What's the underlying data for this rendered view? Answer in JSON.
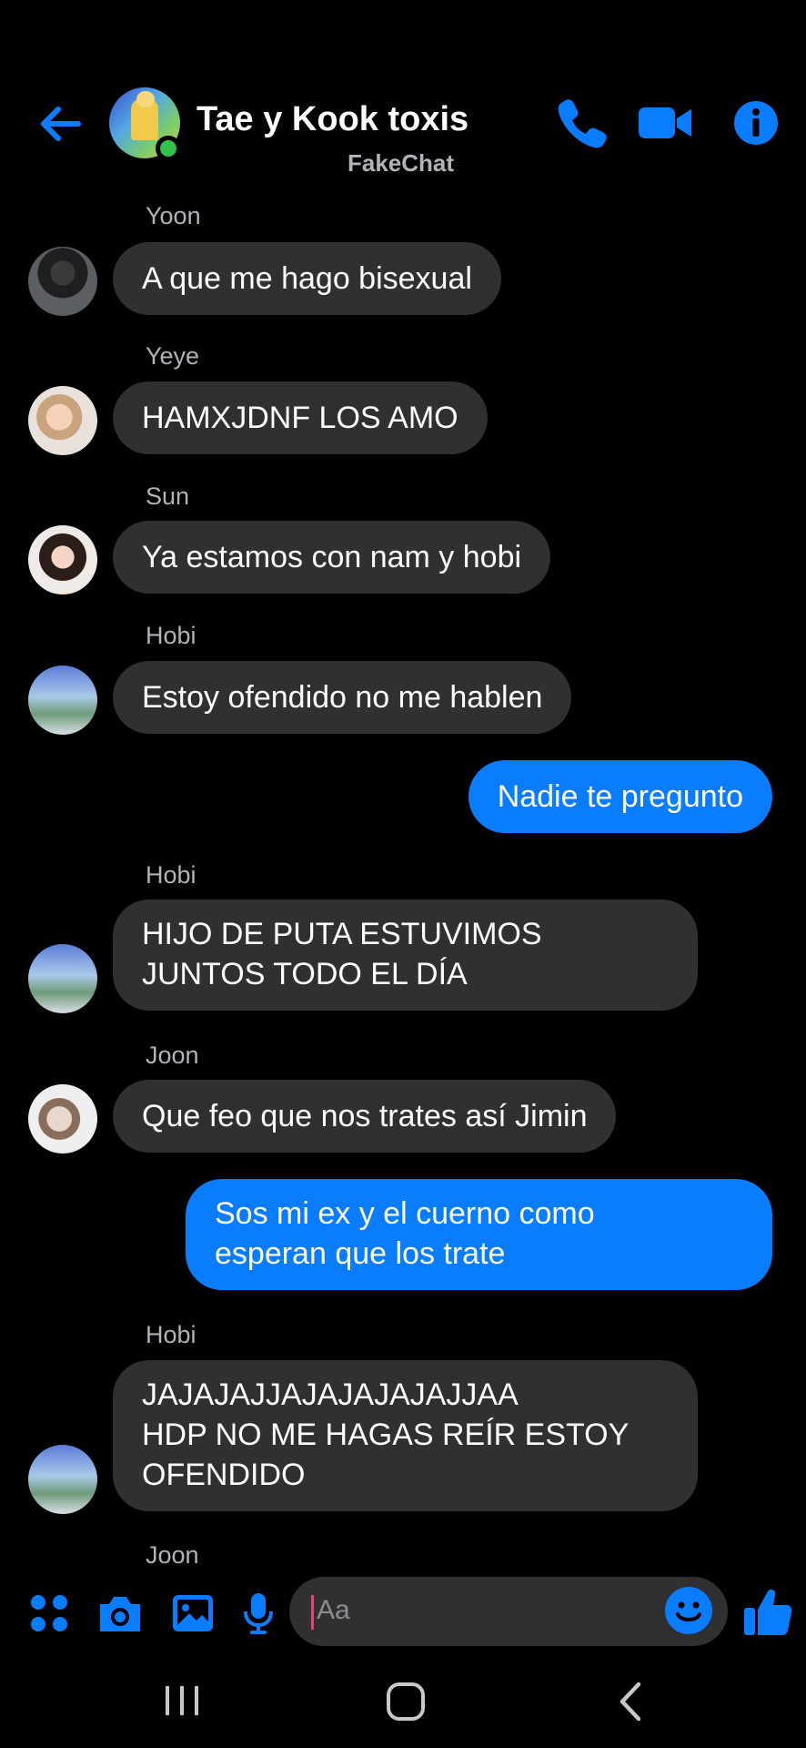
{
  "header": {
    "title": "Tae y Kook toxis",
    "subtitle": "FakeChat"
  },
  "messages": [
    {
      "sender": "Yoon",
      "direction": "incoming",
      "lines": [
        "A que me hago bisexual"
      ]
    },
    {
      "sender": "Yeye",
      "direction": "incoming",
      "lines": [
        "HAMXJDNF LOS AMO"
      ]
    },
    {
      "sender": "Sun",
      "direction": "incoming",
      "lines": [
        "Ya estamos con nam y hobi"
      ]
    },
    {
      "sender": "Hobi",
      "direction": "incoming",
      "lines": [
        "Estoy ofendido no me hablen"
      ]
    },
    {
      "sender": "",
      "direction": "outgoing",
      "lines": [
        "Nadie te pregunto"
      ]
    },
    {
      "sender": "Hobi",
      "direction": "incoming",
      "lines": [
        "HIJO DE PUTA ESTUVIMOS",
        "JUNTOS TODO EL DÍA"
      ]
    },
    {
      "sender": "Joon",
      "direction": "incoming",
      "lines": [
        "Que feo que nos trates así Jimin"
      ]
    },
    {
      "sender": "",
      "direction": "outgoing",
      "lines": [
        "Sos mi ex y el cuerno como",
        "esperan que los trate"
      ]
    },
    {
      "sender": "Hobi",
      "direction": "incoming",
      "lines": [
        "JAJAJAJJAJAJAJAJAJJAA",
        "HDP NO ME HAGAS REÍR ESTOY",
        "OFENDIDO"
      ]
    },
    {
      "sender": "Joon",
      "direction": "incoming",
      "lines": []
    }
  ],
  "composer": {
    "placeholder": "Aa"
  },
  "colors": {
    "accent": "#0a7cff",
    "incoming_bubble": "#303030",
    "online": "#31c24a",
    "background": "#000000"
  },
  "icons": [
    "back-arrow-icon",
    "phone-icon",
    "video-camera-icon",
    "info-icon",
    "apps-icon",
    "camera-icon",
    "gallery-icon",
    "microphone-icon",
    "emoji-icon",
    "thumbs-up-icon"
  ]
}
